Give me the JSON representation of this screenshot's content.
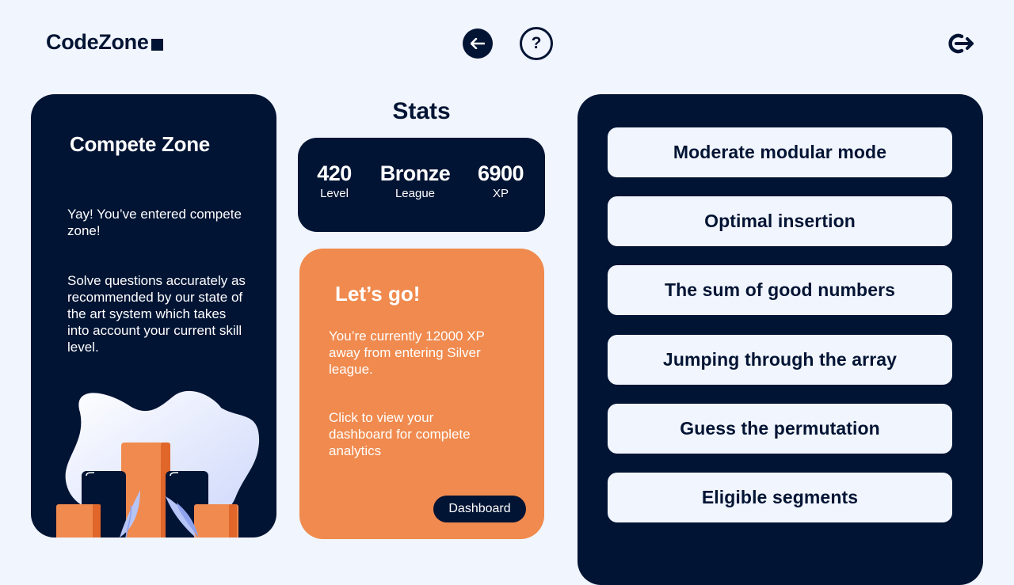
{
  "header": {
    "logo": "CodeZone",
    "back_icon": "arrow-left-icon",
    "help_label": "?",
    "logout_icon": "logout-icon"
  },
  "compete": {
    "title": "Compete Zone",
    "text1": "Yay! You’ve entered compete zone!",
    "text2": "Solve questions accurately as recommended by our state of the art system which takes into account your current skill level."
  },
  "stats": {
    "title": "Stats",
    "level_value": "420",
    "level_label": "Level",
    "league_value": "Bronze",
    "league_label": "League",
    "xp_value": "6900",
    "xp_label": "XP"
  },
  "go": {
    "title": "Let’s go!",
    "text1": "You’re currently 12000 XP away from entering Silver league.",
    "text2": "Click to view your dashboard for complete analytics",
    "button": "Dashboard"
  },
  "problems": [
    "Moderate modular mode",
    "Optimal insertion",
    "The sum of good numbers",
    "Jumping through the array",
    "Guess the permutation",
    "Eligible segments"
  ],
  "colors": {
    "navy": "#021434",
    "background": "#f1f5fd",
    "orange": "#f08a4e"
  }
}
